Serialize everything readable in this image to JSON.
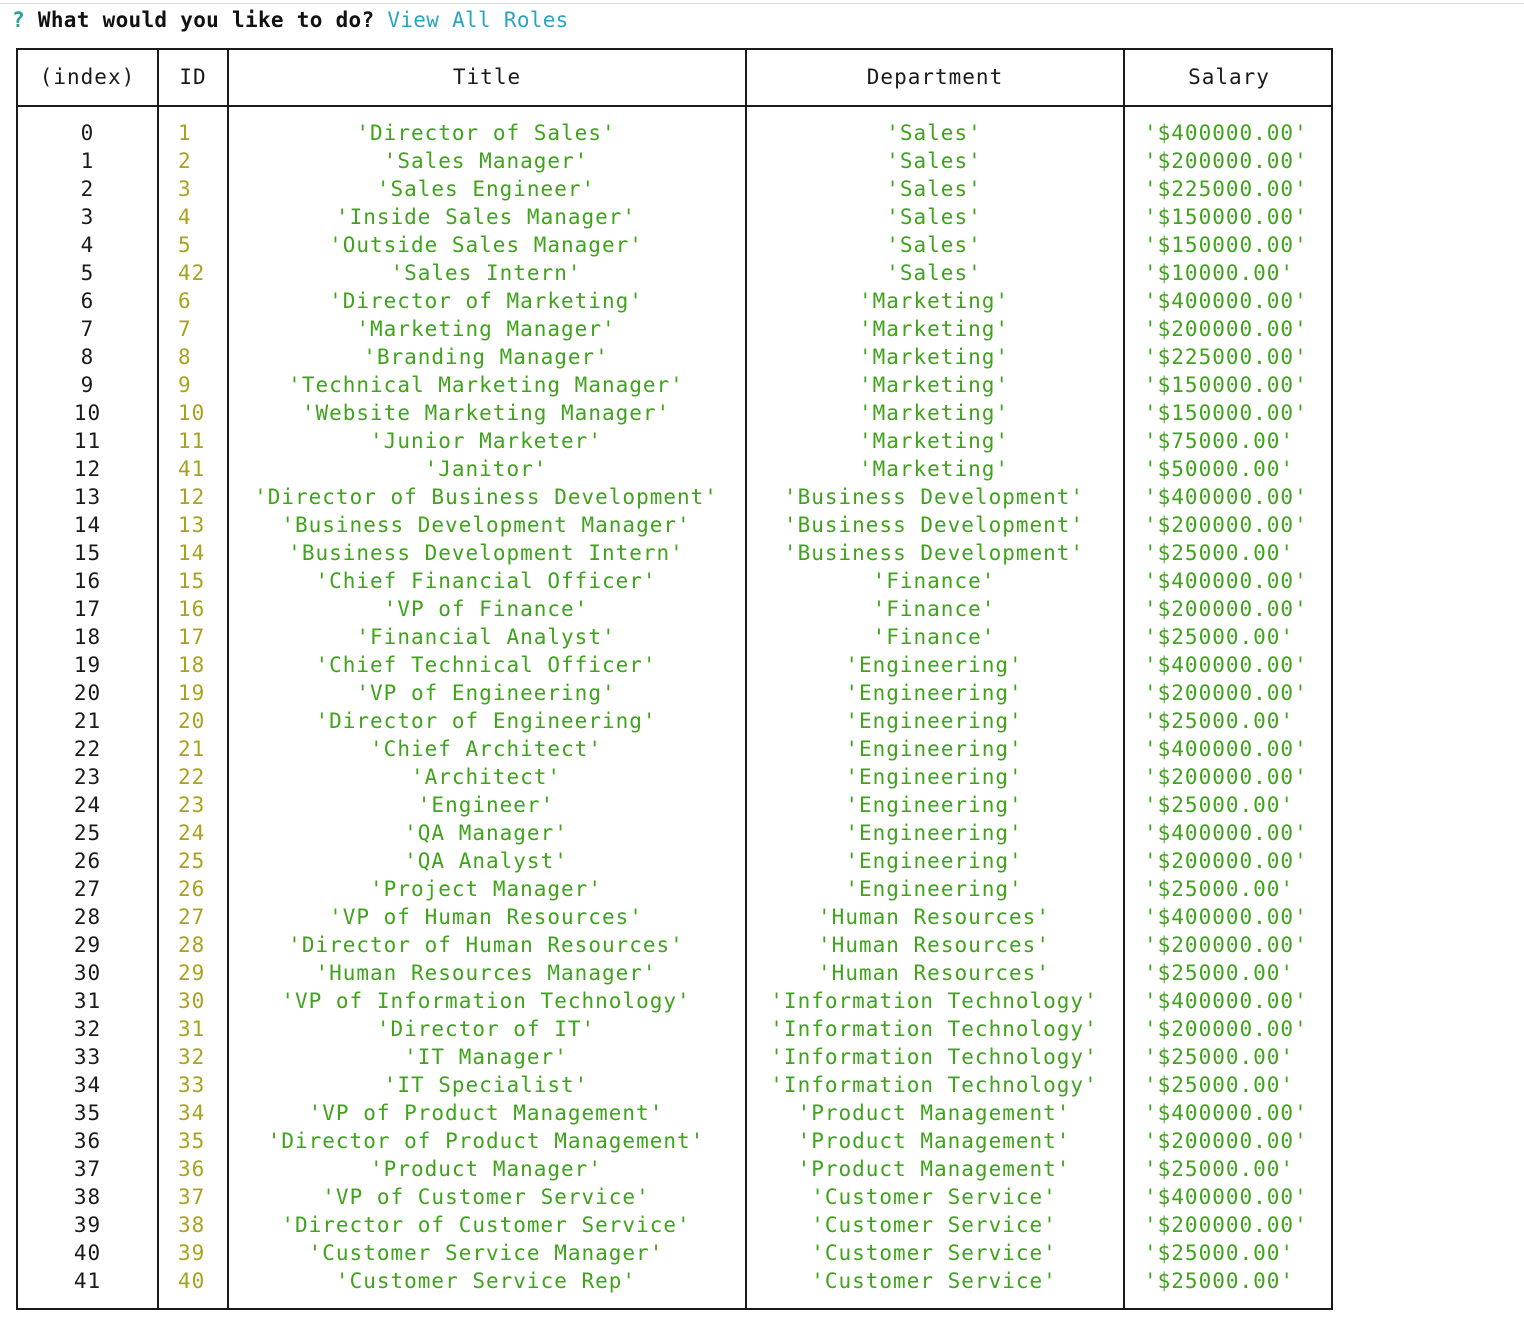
{
  "prompt": {
    "marker": "?",
    "question": "What would you like to do?",
    "answer": "View All Roles"
  },
  "table": {
    "headers": [
      "(index)",
      "ID",
      "Title",
      "Department",
      "Salary"
    ],
    "rows": [
      [
        "0",
        "1",
        "'Director of Sales'",
        "'Sales'",
        "'$400000.00'"
      ],
      [
        "1",
        "2",
        "'Sales Manager'",
        "'Sales'",
        "'$200000.00'"
      ],
      [
        "2",
        "3",
        "'Sales Engineer'",
        "'Sales'",
        "'$225000.00'"
      ],
      [
        "3",
        "4",
        "'Inside Sales Manager'",
        "'Sales'",
        "'$150000.00'"
      ],
      [
        "4",
        "5",
        "'Outside Sales Manager'",
        "'Sales'",
        "'$150000.00'"
      ],
      [
        "5",
        "42",
        "'Sales Intern'",
        "'Sales'",
        "'$10000.00'"
      ],
      [
        "6",
        "6",
        "'Director of Marketing'",
        "'Marketing'",
        "'$400000.00'"
      ],
      [
        "7",
        "7",
        "'Marketing Manager'",
        "'Marketing'",
        "'$200000.00'"
      ],
      [
        "8",
        "8",
        "'Branding Manager'",
        "'Marketing'",
        "'$225000.00'"
      ],
      [
        "9",
        "9",
        "'Technical Marketing Manager'",
        "'Marketing'",
        "'$150000.00'"
      ],
      [
        "10",
        "10",
        "'Website Marketing Manager'",
        "'Marketing'",
        "'$150000.00'"
      ],
      [
        "11",
        "11",
        "'Junior Marketer'",
        "'Marketing'",
        "'$75000.00'"
      ],
      [
        "12",
        "41",
        "'Janitor'",
        "'Marketing'",
        "'$50000.00'"
      ],
      [
        "13",
        "12",
        "'Director of Business Development'",
        "'Business Development'",
        "'$400000.00'"
      ],
      [
        "14",
        "13",
        "'Business Development Manager'",
        "'Business Development'",
        "'$200000.00'"
      ],
      [
        "15",
        "14",
        "'Business Development Intern'",
        "'Business Development'",
        "'$25000.00'"
      ],
      [
        "16",
        "15",
        "'Chief Financial Officer'",
        "'Finance'",
        "'$400000.00'"
      ],
      [
        "17",
        "16",
        "'VP of Finance'",
        "'Finance'",
        "'$200000.00'"
      ],
      [
        "18",
        "17",
        "'Financial Analyst'",
        "'Finance'",
        "'$25000.00'"
      ],
      [
        "19",
        "18",
        "'Chief Technical Officer'",
        "'Engineering'",
        "'$400000.00'"
      ],
      [
        "20",
        "19",
        "'VP of Engineering'",
        "'Engineering'",
        "'$200000.00'"
      ],
      [
        "21",
        "20",
        "'Director of Engineering'",
        "'Engineering'",
        "'$25000.00'"
      ],
      [
        "22",
        "21",
        "'Chief Architect'",
        "'Engineering'",
        "'$400000.00'"
      ],
      [
        "23",
        "22",
        "'Architect'",
        "'Engineering'",
        "'$200000.00'"
      ],
      [
        "24",
        "23",
        "'Engineer'",
        "'Engineering'",
        "'$25000.00'"
      ],
      [
        "25",
        "24",
        "'QA Manager'",
        "'Engineering'",
        "'$400000.00'"
      ],
      [
        "26",
        "25",
        "'QA Analyst'",
        "'Engineering'",
        "'$200000.00'"
      ],
      [
        "27",
        "26",
        "'Project Manager'",
        "'Engineering'",
        "'$25000.00'"
      ],
      [
        "28",
        "27",
        "'VP of Human Resources'",
        "'Human Resources'",
        "'$400000.00'"
      ],
      [
        "29",
        "28",
        "'Director of Human Resources'",
        "'Human Resources'",
        "'$200000.00'"
      ],
      [
        "30",
        "29",
        "'Human Resources Manager'",
        "'Human Resources'",
        "'$25000.00'"
      ],
      [
        "31",
        "30",
        "'VP of Information Technology'",
        "'Information Technology'",
        "'$400000.00'"
      ],
      [
        "32",
        "31",
        "'Director of IT'",
        "'Information Technology'",
        "'$200000.00'"
      ],
      [
        "33",
        "32",
        "'IT Manager'",
        "'Information Technology'",
        "'$25000.00'"
      ],
      [
        "34",
        "33",
        "'IT Specialist'",
        "'Information Technology'",
        "'$25000.00'"
      ],
      [
        "35",
        "34",
        "'VP of Product Management'",
        "'Product Management'",
        "'$400000.00'"
      ],
      [
        "36",
        "35",
        "'Director of Product Management'",
        "'Product Management'",
        "'$200000.00'"
      ],
      [
        "37",
        "36",
        "'Product Manager'",
        "'Product Management'",
        "'$25000.00'"
      ],
      [
        "38",
        "37",
        "'VP of Customer Service'",
        "'Customer Service'",
        "'$400000.00'"
      ],
      [
        "39",
        "38",
        "'Director of Customer Service'",
        "'Customer Service'",
        "'$200000.00'"
      ],
      [
        "40",
        "39",
        "'Customer Service Manager'",
        "'Customer Service'",
        "'$25000.00'"
      ],
      [
        "41",
        "40",
        "'Customer Service Rep'",
        "'Customer Service'",
        "'$25000.00'"
      ]
    ]
  },
  "colors": {
    "index": "#1a1a1a",
    "id": "#a8a21c",
    "string": "#3fa31b",
    "prompt_marker": "#2aa198",
    "prompt_answer": "#2ba3c6"
  }
}
